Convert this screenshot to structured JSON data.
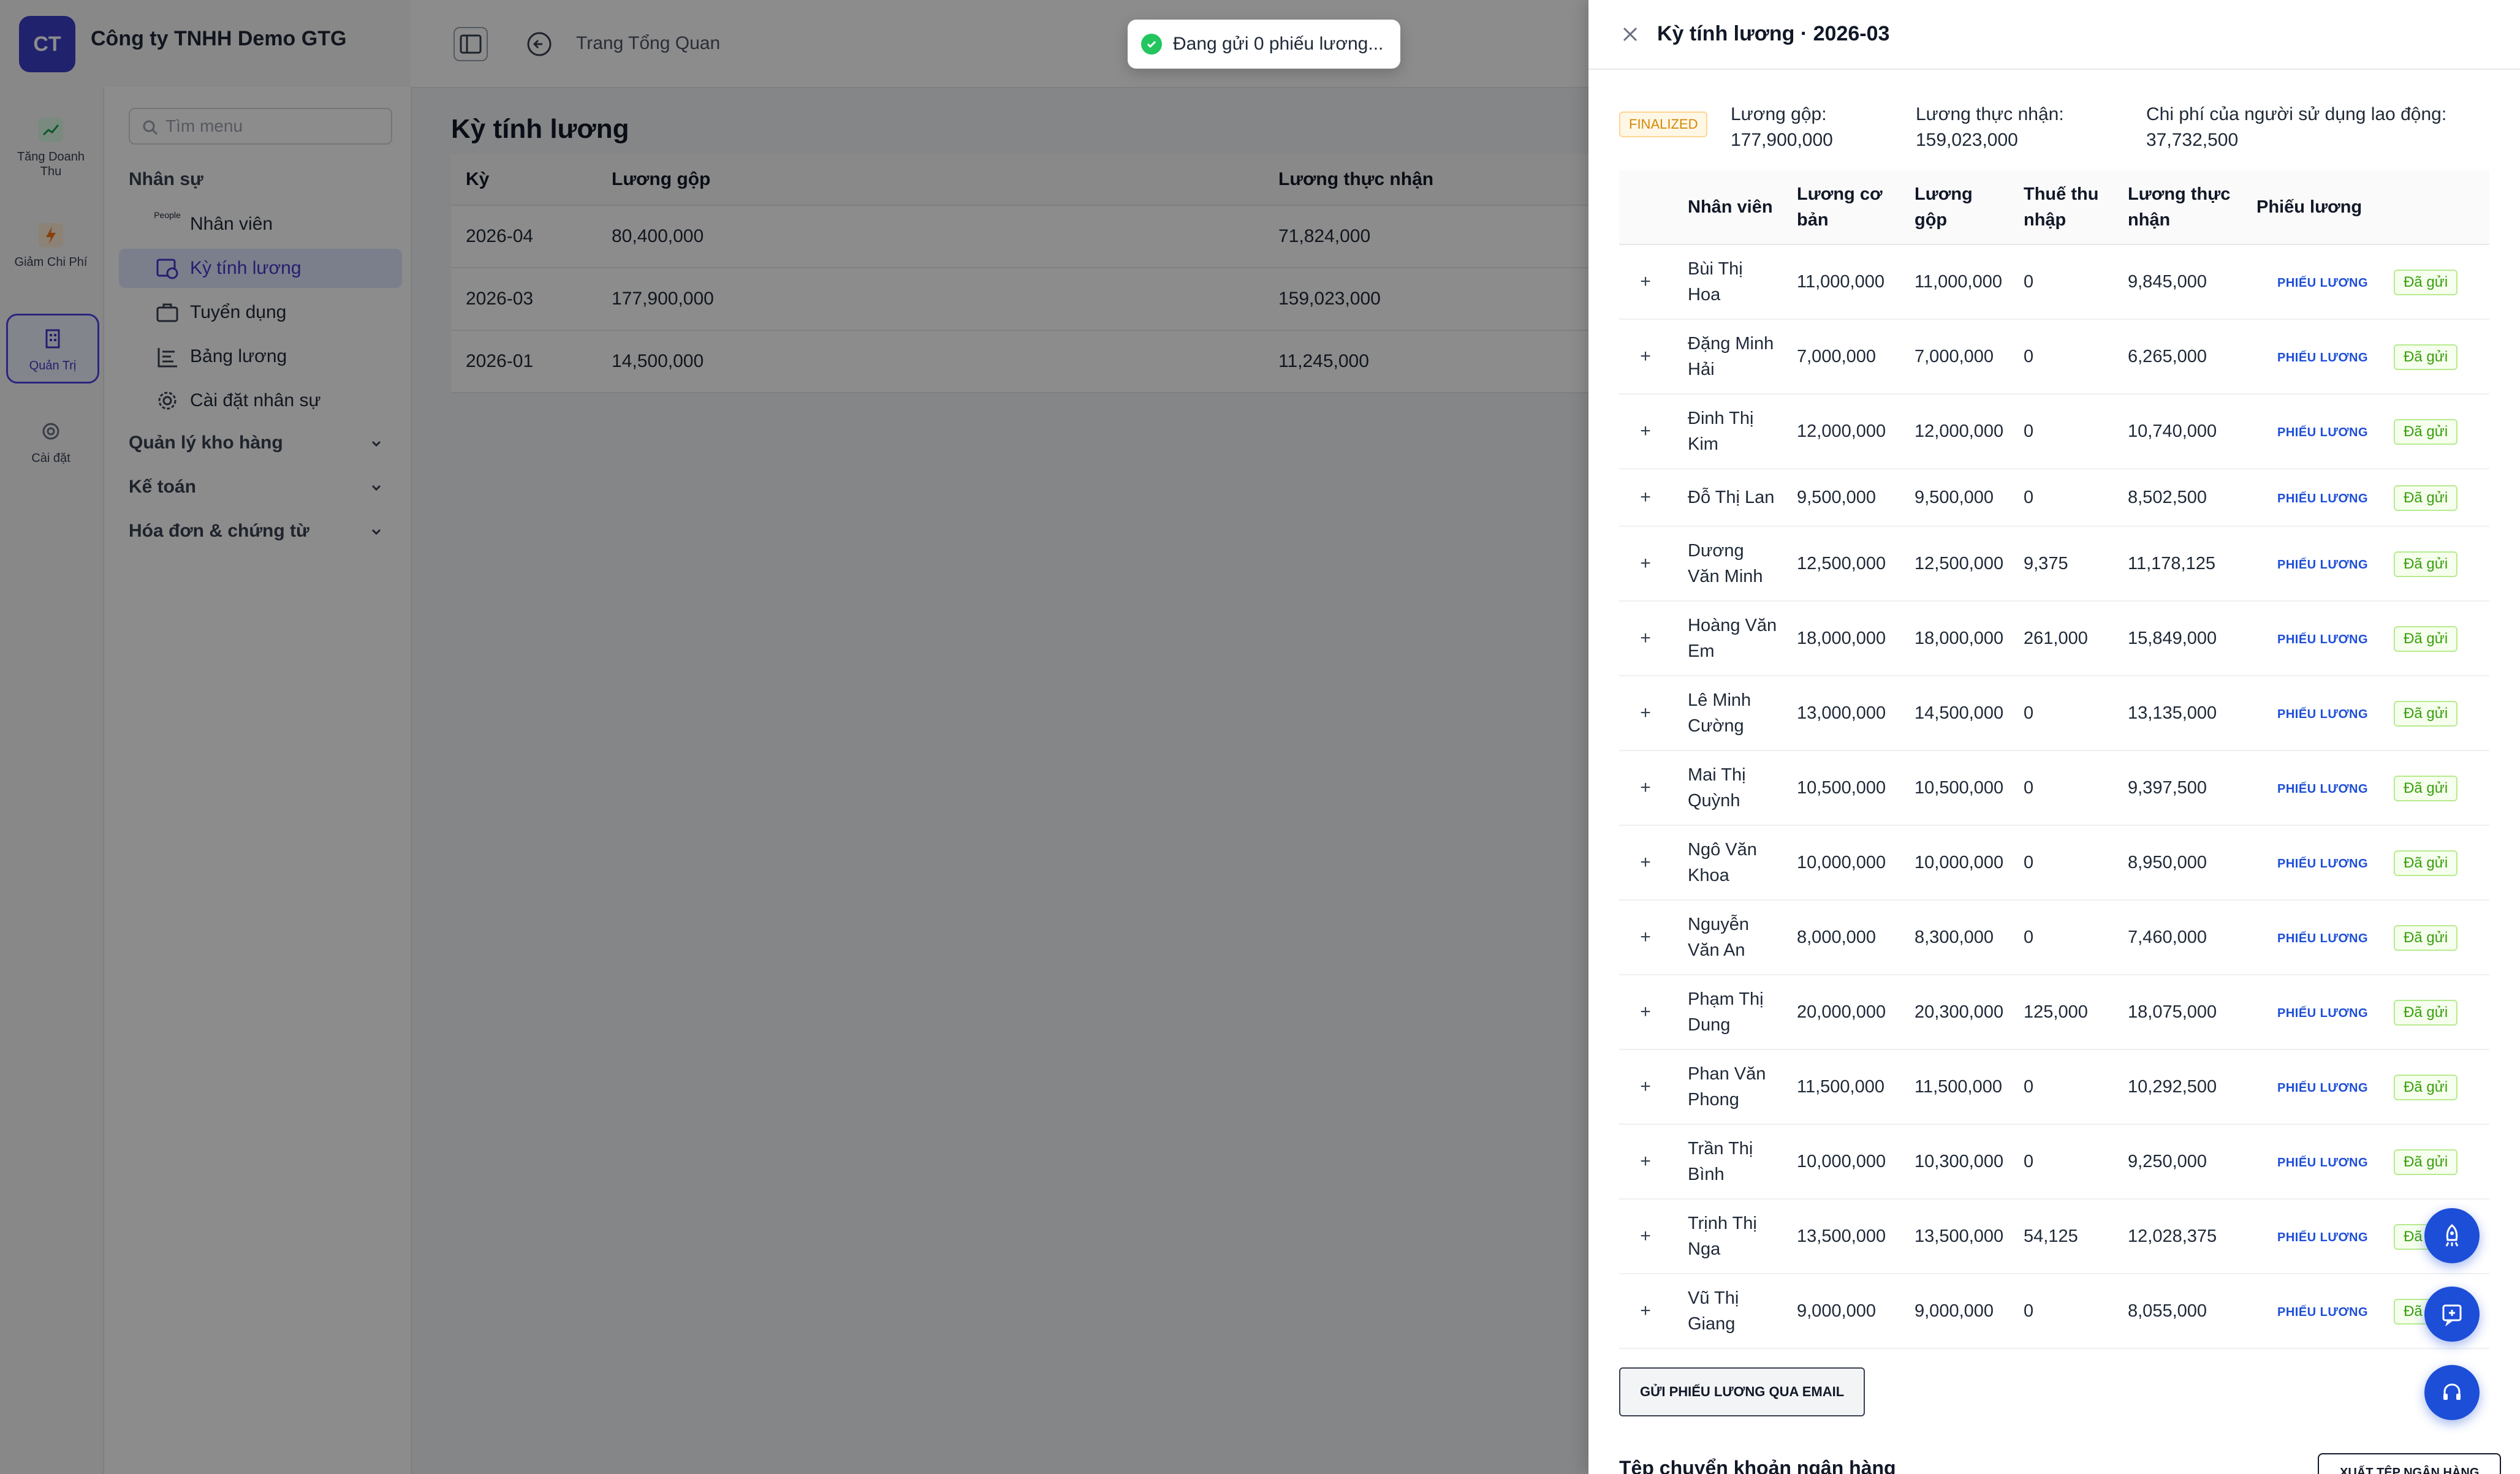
{
  "app": {
    "logo_initials": "CT",
    "company_name": "Công ty TNHH Demo GTG"
  },
  "rail": {
    "items": [
      {
        "label": "Tăng Doanh Thu",
        "icon": "trend-up-icon"
      },
      {
        "label": "Giảm Chi Phí",
        "icon": "lightning-icon"
      },
      {
        "label": "Quản Trị",
        "icon": "building-icon"
      },
      {
        "label": "Cài đặt",
        "icon": "gear-icon"
      }
    ]
  },
  "sidebar": {
    "search_placeholder": "Tìm menu",
    "group_hr": "Nhân sự",
    "items": [
      {
        "label": "Nhân viên",
        "icon": "people-icon",
        "icon_caption": "People"
      },
      {
        "label": "Kỳ tính lương",
        "icon": "payroll-icon"
      },
      {
        "label": "Tuyển dụng",
        "icon": "briefcase-icon"
      },
      {
        "label": "Bảng lương",
        "icon": "list-icon"
      },
      {
        "label": "Cài đặt nhân sự",
        "icon": "gear-icon"
      }
    ],
    "groups": [
      {
        "label": "Quản lý kho hàng"
      },
      {
        "label": "Kế toán"
      },
      {
        "label": "Hóa đơn & chứng từ"
      }
    ]
  },
  "topbar": {
    "breadcrumb": "Trang Tổng Quan"
  },
  "main": {
    "title": "Kỳ tính lương",
    "columns": [
      "Kỳ",
      "Lương gộp",
      "Lương thực nhận"
    ],
    "rows": [
      [
        "2026-04",
        "80,400,000",
        "71,824,000"
      ],
      [
        "2026-03",
        "177,900,000",
        "159,023,000"
      ],
      [
        "2026-01",
        "14,500,000",
        "11,245,000"
      ]
    ]
  },
  "toast": {
    "message": "Đang gửi 0 phiếu lương..."
  },
  "drawer": {
    "title": "Kỳ tính lương · 2026-03",
    "status": "FINALIZED",
    "summary": {
      "gross_label": "Lương gộp:",
      "gross_value": "177,900,000",
      "net_label": "Lương thực nhận:",
      "net_value": "159,023,000",
      "employer_label": "Chi phí của người sử dụng lao động:",
      "employer_value": "37,732,500"
    },
    "columns": {
      "employee": "Nhân viên",
      "base": "Lương cơ bản",
      "gross": "Lương gộp",
      "tax": "Thuế thu nhập",
      "net": "Lương thực nhận",
      "payslip": "Phiếu lương"
    },
    "payslip_link_label": "PHIẾU LƯƠNG",
    "sent_label": "Đã gửi",
    "rows": [
      {
        "name": "Bùi Thị Hoa",
        "base": "11,000,000",
        "gross": "11,000,000",
        "tax": "0",
        "net": "9,845,000"
      },
      {
        "name": "Đặng Minh Hải",
        "base": "7,000,000",
        "gross": "7,000,000",
        "tax": "0",
        "net": "6,265,000"
      },
      {
        "name": "Đinh Thị Kim",
        "base": "12,000,000",
        "gross": "12,000,000",
        "tax": "0",
        "net": "10,740,000"
      },
      {
        "name": "Đỗ Thị Lan",
        "base": "9,500,000",
        "gross": "9,500,000",
        "tax": "0",
        "net": "8,502,500"
      },
      {
        "name": "Dương Văn Minh",
        "base": "12,500,000",
        "gross": "12,500,000",
        "tax": "9,375",
        "net": "11,178,125"
      },
      {
        "name": "Hoàng Văn Em",
        "base": "18,000,000",
        "gross": "18,000,000",
        "tax": "261,000",
        "net": "15,849,000"
      },
      {
        "name": "Lê Minh Cường",
        "base": "13,000,000",
        "gross": "14,500,000",
        "tax": "0",
        "net": "13,135,000"
      },
      {
        "name": "Mai Thị Quỳnh",
        "base": "10,500,000",
        "gross": "10,500,000",
        "tax": "0",
        "net": "9,397,500"
      },
      {
        "name": "Ngô Văn Khoa",
        "base": "10,000,000",
        "gross": "10,000,000",
        "tax": "0",
        "net": "8,950,000"
      },
      {
        "name": "Nguyễn Văn An",
        "base": "8,000,000",
        "gross": "8,300,000",
        "tax": "0",
        "net": "7,460,000"
      },
      {
        "name": "Phạm Thị Dung",
        "base": "20,000,000",
        "gross": "20,300,000",
        "tax": "125,000",
        "net": "18,075,000"
      },
      {
        "name": "Phan Văn Phong",
        "base": "11,500,000",
        "gross": "11,500,000",
        "tax": "0",
        "net": "10,292,500"
      },
      {
        "name": "Trần Thị Bình",
        "base": "10,000,000",
        "gross": "10,300,000",
        "tax": "0",
        "net": "9,250,000"
      },
      {
        "name": "Trịnh Thị Nga",
        "base": "13,500,000",
        "gross": "13,500,000",
        "tax": "54,125",
        "net": "12,028,375"
      },
      {
        "name": "Vũ Thị Giang",
        "base": "9,000,000",
        "gross": "9,000,000",
        "tax": "0",
        "net": "8,055,000"
      }
    ],
    "email_button": "GỬI PHIẾU LƯƠNG QUA EMAIL",
    "bank_section_title": "Tệp chuyển khoản ngân hàng",
    "bank_export_button": "XUẤT TỆP NGÂN HÀNG"
  },
  "colors": {
    "brand": "#3b3fc9",
    "link": "#1d4ed8",
    "success": "#389e0d",
    "warning": "#d48806",
    "fab": "#1d4ed8"
  },
  "fabs": [
    "rocket-icon",
    "ai-assistant-icon",
    "headset-icon"
  ]
}
